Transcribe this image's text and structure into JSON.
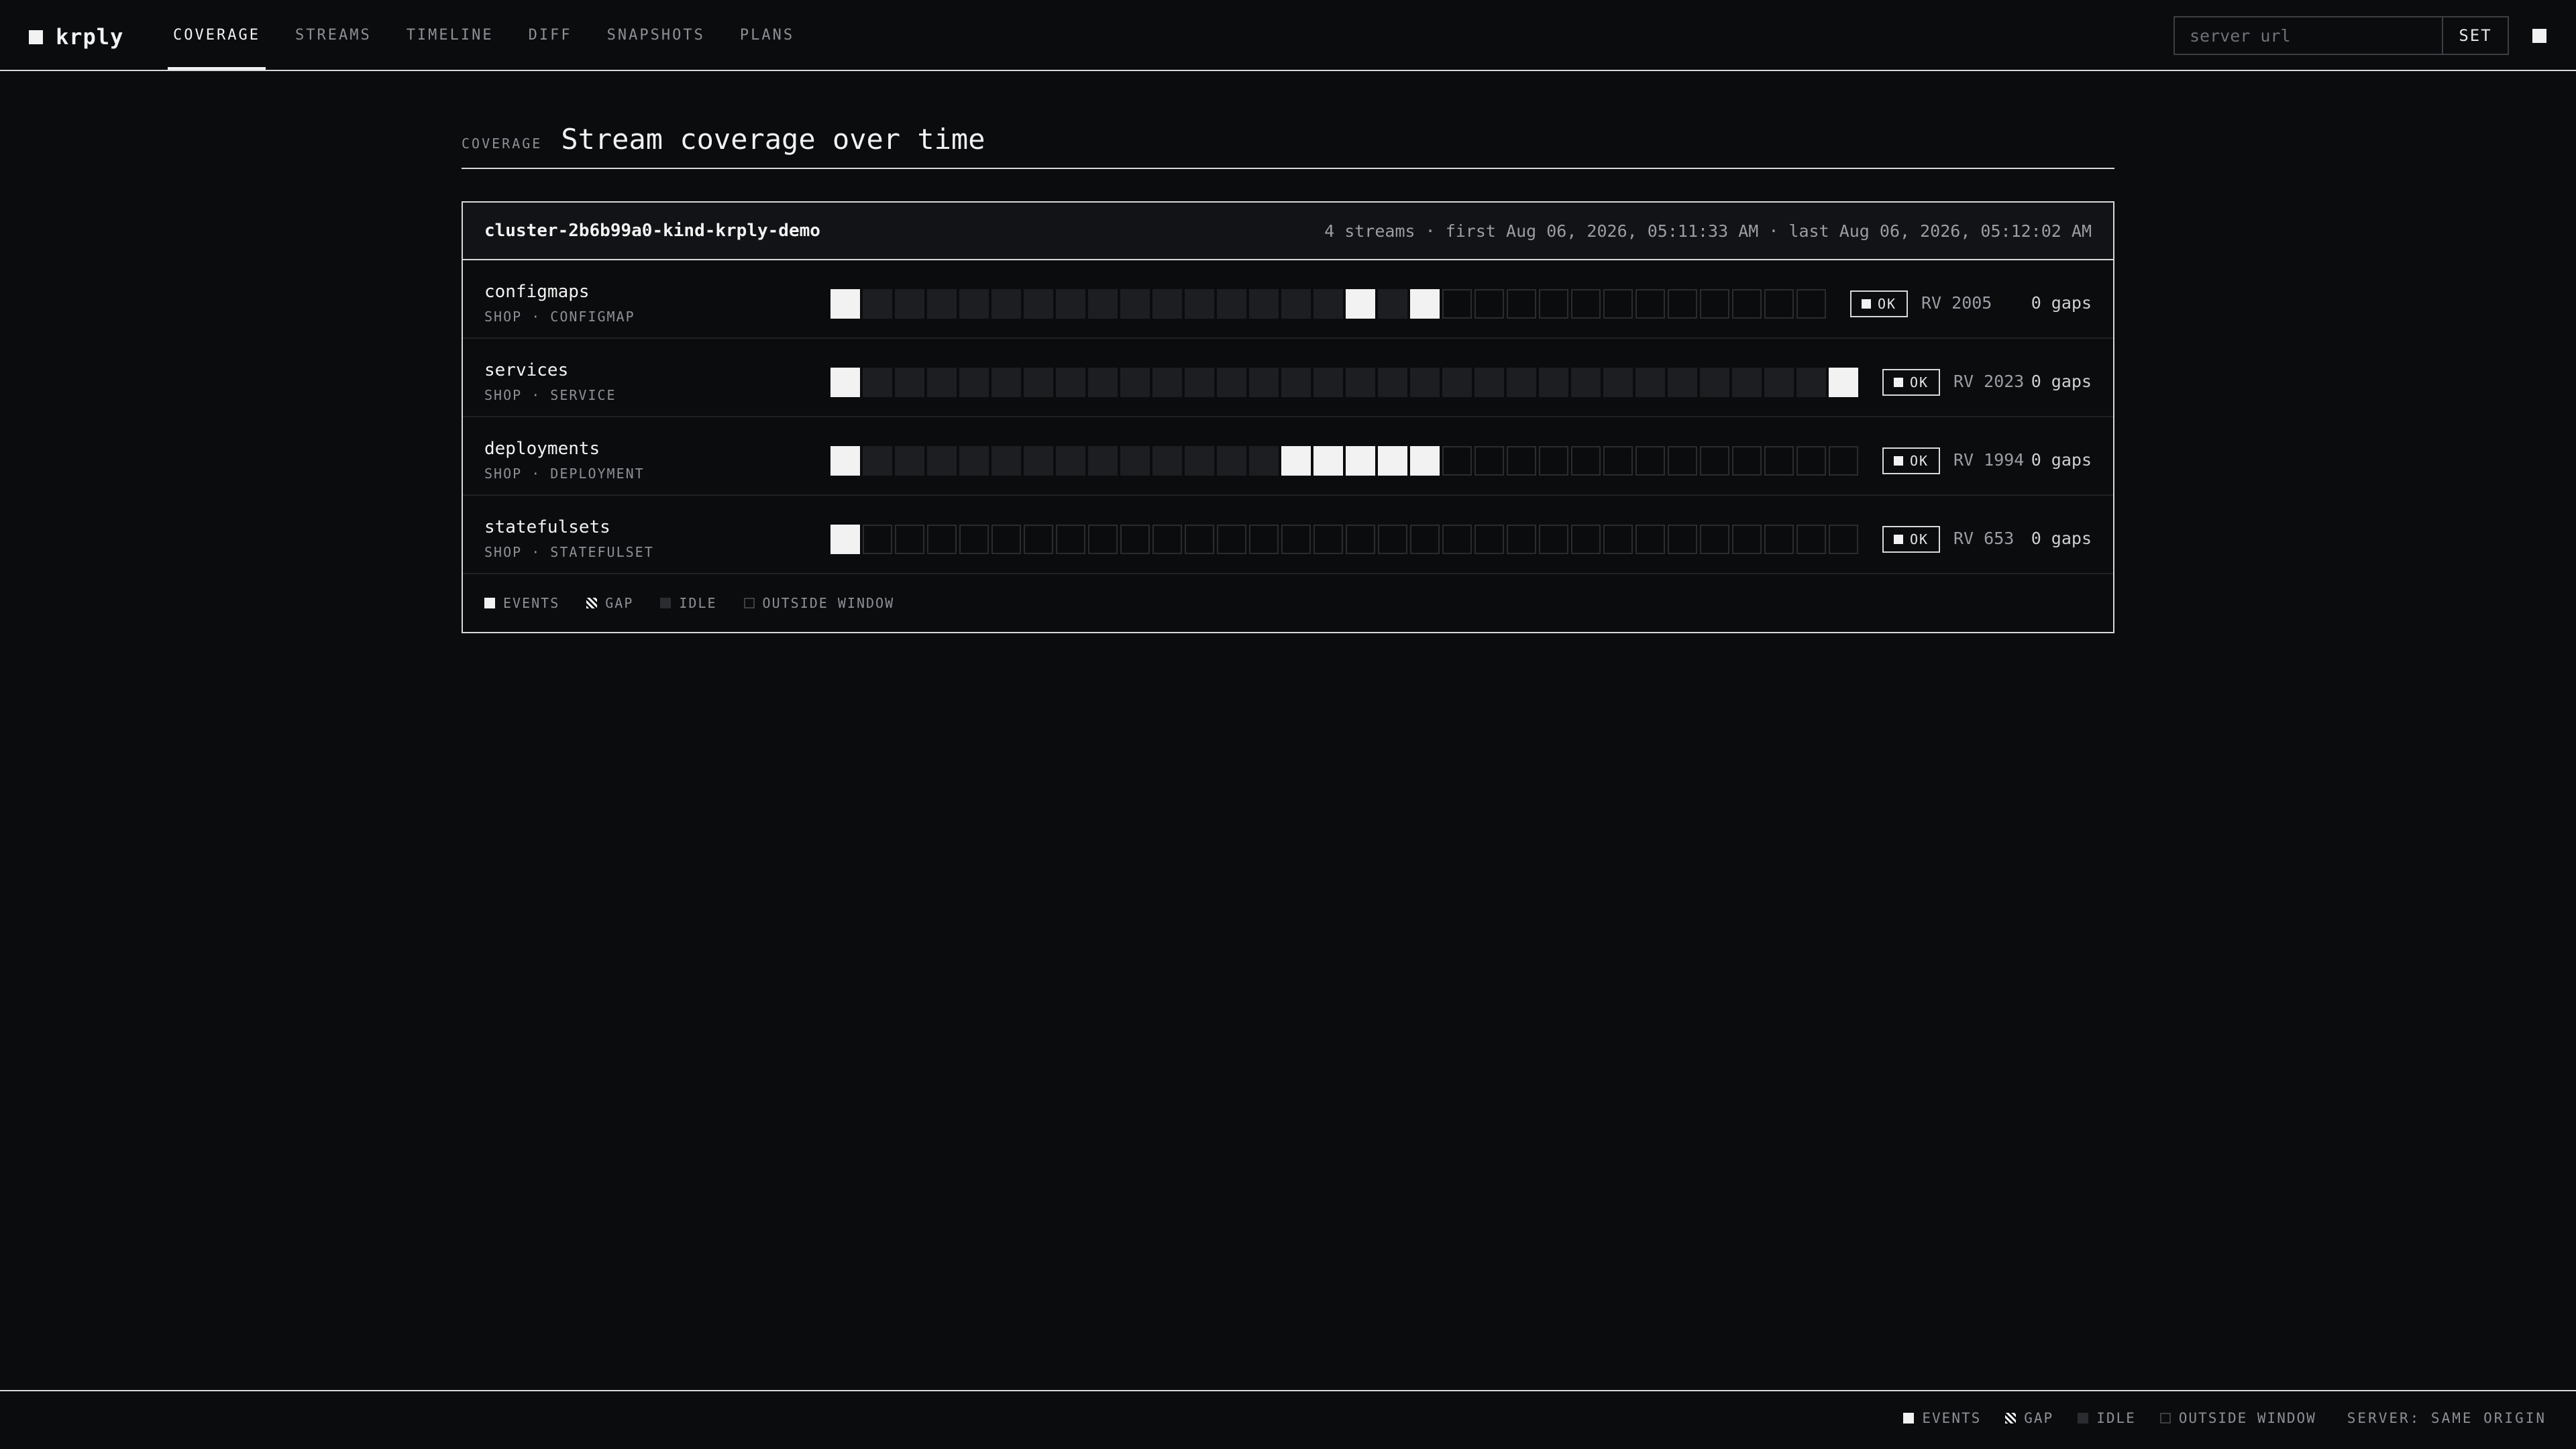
{
  "app": {
    "name": "krply"
  },
  "nav": {
    "tabs": [
      {
        "label": "COVERAGE",
        "active": true
      },
      {
        "label": "STREAMS"
      },
      {
        "label": "TIMELINE"
      },
      {
        "label": "DIFF"
      },
      {
        "label": "SNAPSHOTS"
      },
      {
        "label": "PLANS"
      }
    ]
  },
  "server": {
    "placeholder": "server url",
    "set_label": "SET"
  },
  "page": {
    "kicker": "COVERAGE",
    "title": "Stream coverage over time"
  },
  "cluster": {
    "name": "cluster-2b6b99a0-kind-krply-demo",
    "meta": "4 streams · first Aug 06, 2026, 05:11:33 AM · last Aug 06, 2026, 05:12:02 AM"
  },
  "streams": [
    {
      "name": "configmaps",
      "sub": "SHOP · CONFIGMAP",
      "cells": "EIIIIIIIIIIIIIIIEIEOOOOOOOOOOOO",
      "status": "OK",
      "rv": "RV 2005",
      "gaps": "0 gaps"
    },
    {
      "name": "services",
      "sub": "SHOP · SERVICE",
      "cells": "EIIIIIIIIIIIIIIIIIIIIIIIIIIIIIIE",
      "status": "OK",
      "rv": "RV 2023",
      "gaps": "0 gaps"
    },
    {
      "name": "deployments",
      "sub": "SHOP · DEPLOYMENT",
      "cells": "EIIIIIIIIIIIIIEEEEEOOOOOOOOOOOOO",
      "status": "OK",
      "rv": "RV 1994",
      "gaps": "0 gaps"
    },
    {
      "name": "statefulsets",
      "sub": "SHOP · STATEFULSET",
      "cells": "EOOOOOOOOOOOOOOOOOOOOOOOOOOOOOOO",
      "status": "OK",
      "rv": "RV 653",
      "gaps": "0 gaps"
    }
  ],
  "legend": {
    "events": "EVENTS",
    "gap": "GAP",
    "idle": "IDLE",
    "outside": "OUTSIDE WINDOW"
  },
  "footer": {
    "server_status": "SERVER: SAME ORIGIN"
  }
}
